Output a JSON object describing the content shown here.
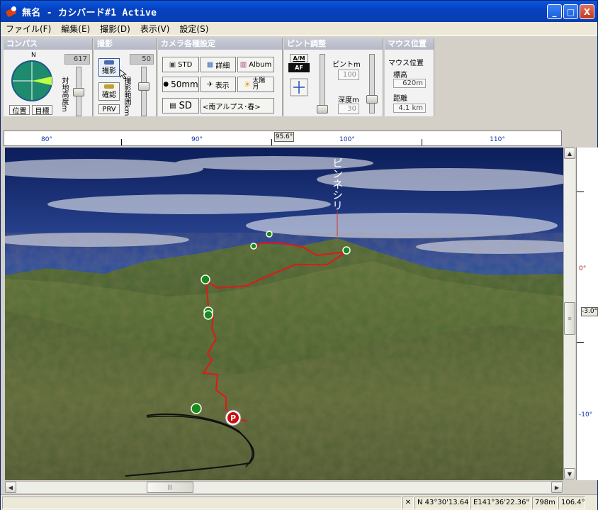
{
  "window": {
    "title": "無名 - カシバード#1  Active",
    "minimize": "_",
    "maximize": "□",
    "close": "X"
  },
  "menu": [
    {
      "label": "ファイル(F)"
    },
    {
      "label": "編集(E)"
    },
    {
      "label": "撮影(D)"
    },
    {
      "label": "表示(V)"
    },
    {
      "label": "設定(S)"
    }
  ],
  "compass_panel": {
    "title": "コンパス",
    "north": "N",
    "altitude_value": "617",
    "altitude_label": "対地高度m",
    "position_button": "位置",
    "target_button": "目標"
  },
  "shoot_panel": {
    "title": "撮影",
    "shoot_button": "撮影",
    "confirm_button": "確認",
    "prv_button": "PRV",
    "range_value": "50",
    "range_label": "撮影範囲km"
  },
  "camera_panel": {
    "title": "カメラ各種設定",
    "std_button": "STD",
    "detail_button": "詳細",
    "album_button": "Album",
    "lens_button": "50mm",
    "display_button": "表示",
    "sun_moon_button": "太陽月",
    "sd_button": "SD",
    "season_value": "<南アルプス･春>"
  },
  "focus_panel": {
    "title": "ピント調整",
    "am_label": "A/M",
    "af_label": "AF",
    "focus_label": "ピントm",
    "focus_value": "100",
    "depth_label": "深度m",
    "depth_value": "30"
  },
  "mouse_panel": {
    "title": "マウス位置",
    "heading": "マウス位置",
    "elevation_label": "標高",
    "elevation_value": "620m",
    "distance_label": "距離",
    "distance_value": "4.1 km"
  },
  "ruler": {
    "labels": [
      "80°",
      "90°",
      "100°",
      "110°"
    ],
    "current": "95.6°"
  },
  "pitch": {
    "labels": [
      "0°",
      "-10°"
    ],
    "current": "-3.0°"
  },
  "scene": {
    "peak_label": "ピンネシリ",
    "parking_label": "P"
  },
  "status": {
    "latitude": "N 43°30'13.64\"",
    "longitude": "E141°36'22.36\"",
    "elevation": "798m",
    "bearing": "106.4°"
  },
  "colors": {
    "route": "#e01818",
    "trail": "#101010",
    "waypoint": "#1a8a1a",
    "title_bar": "#0a58e0"
  }
}
